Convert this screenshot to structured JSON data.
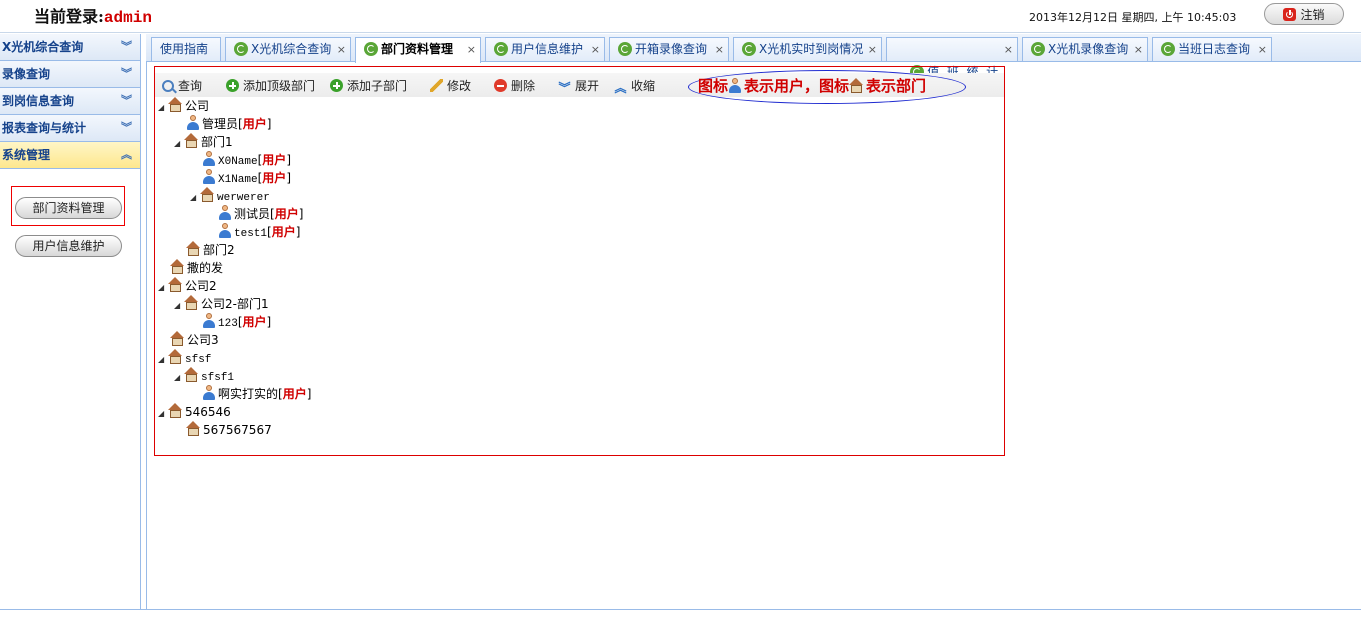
{
  "header": {
    "login_label": "当前登录:",
    "username": "admin",
    "datetime": "2013年12月12日 星期四, 上午 10:45:03",
    "logout_label": "注销"
  },
  "sidebar": {
    "sections": [
      {
        "label": "X光机综合查询"
      },
      {
        "label": "录像查询"
      },
      {
        "label": "到岗信息查询"
      },
      {
        "label": "报表查询与统计"
      },
      {
        "label": "系统管理"
      }
    ],
    "buttons": [
      {
        "label": "部门资料管理"
      },
      {
        "label": "用户信息维护"
      }
    ]
  },
  "tabs": [
    {
      "label": "使用指南"
    },
    {
      "label": "X光机综合查询"
    },
    {
      "label": "部门资料管理"
    },
    {
      "label": "用户信息维护"
    },
    {
      "label": "开箱录像查询"
    },
    {
      "label": "X光机实时到岗情况"
    },
    {
      "label": "值  班  统  计"
    },
    {
      "label": "X光机录像查询"
    },
    {
      "label": "当班日志查询"
    }
  ],
  "toolbar": {
    "search": "查询",
    "add_top": "添加顶级部门",
    "add_child": "添加子部门",
    "edit": "修改",
    "delete": "删除",
    "expand": "展开",
    "collapse": "收缩"
  },
  "note": {
    "part1": "图标",
    "part2": "表示用户，图标",
    "part3": "表示部门"
  },
  "tree": {
    "user_tag": "用户",
    "nodes": [
      {
        "label": "公司"
      },
      {
        "label": "管理员"
      },
      {
        "label": "部门1"
      },
      {
        "label": "X0Name"
      },
      {
        "label": "X1Name"
      },
      {
        "label": "werwerer"
      },
      {
        "label": "测试员"
      },
      {
        "label": "test1"
      },
      {
        "label": "部门2"
      },
      {
        "label": "撒的发"
      },
      {
        "label": "公司2"
      },
      {
        "label": "公司2-部门1"
      },
      {
        "label": "123"
      },
      {
        "label": "公司3"
      },
      {
        "label": "sfsf"
      },
      {
        "label": "sfsf1"
      },
      {
        "label": "啊实打实的"
      },
      {
        "label": "546546"
      },
      {
        "label": "567567567"
      }
    ]
  },
  "colors": {
    "accent": "#15428b",
    "alert_red": "#d00000",
    "border_blue": "#99bbe8"
  }
}
